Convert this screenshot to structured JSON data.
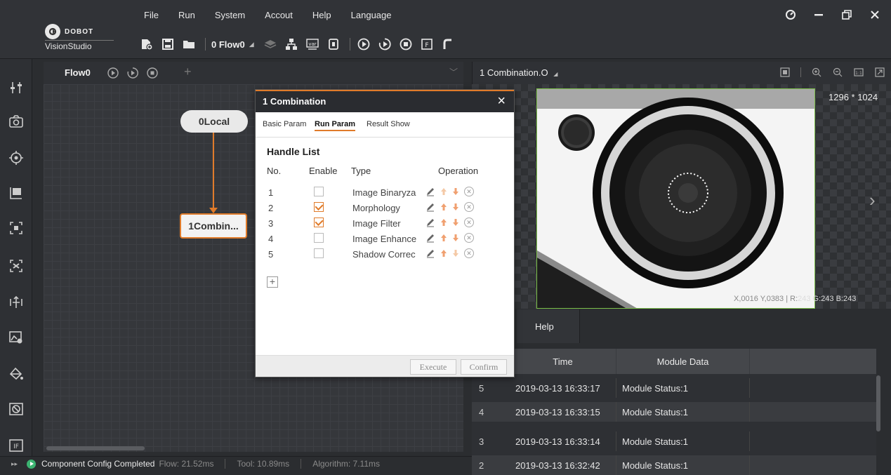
{
  "brand": {
    "name": "DOBOT",
    "product": "VisionStudio"
  },
  "menu": [
    "File",
    "Run",
    "System",
    "Accout",
    "Help",
    "Language"
  ],
  "toolbar": {
    "flow_select": "0 Flow0"
  },
  "flow_tab": {
    "label": "Flow0"
  },
  "nodes": {
    "local": "0Local",
    "combination": "1Combin..."
  },
  "image_panel": {
    "title": "1 Combination.O",
    "resolution": "1296 * 1024",
    "coords": "X,0016  Y,0383  |  R:",
    "rgb": "243  G:243  B:243"
  },
  "results": {
    "tab": "Help",
    "columns": [
      "Time",
      "Module Data"
    ],
    "rows": [
      {
        "no": "5",
        "time": "2019-03-13 16:33:17",
        "data": "Module Status:1"
      },
      {
        "no": "4",
        "time": "2019-03-13 16:33:15",
        "data": "Module Status:1"
      },
      {
        "no": "3",
        "time": "2019-03-13 16:33:14",
        "data": "Module Status:1"
      },
      {
        "no": "2",
        "time": "2019-03-13 16:32:42",
        "data": "Module Status:1"
      }
    ]
  },
  "dialog": {
    "title": "1 Combination",
    "tabs": [
      "Basic Param",
      "Run Param",
      "Result Show"
    ],
    "active_tab": "Run Param",
    "section": "Handle List",
    "columns": {
      "no": "No.",
      "enable": "Enable",
      "type": "Type",
      "operation": "Operation"
    },
    "handles": [
      {
        "no": "1",
        "enabled": false,
        "type": "Image Binaryza"
      },
      {
        "no": "2",
        "enabled": true,
        "type": "Morphology"
      },
      {
        "no": "3",
        "enabled": true,
        "type": "Image Filter"
      },
      {
        "no": "4",
        "enabled": false,
        "type": "Image Enhance"
      },
      {
        "no": "5",
        "enabled": false,
        "type": "Shadow Correc"
      }
    ],
    "buttons": {
      "execute": "Execute",
      "confirm": "Confirm"
    }
  },
  "status": {
    "message": "Component Config Completed",
    "flow": "Flow: 21.52ms",
    "tool": "Tool: 10.89ms",
    "algorithm": "Algorithm: 7.11ms"
  },
  "colors": {
    "accent": "#e07b2a",
    "panel": "#2b2d30",
    "frame": "#7cc04a"
  }
}
